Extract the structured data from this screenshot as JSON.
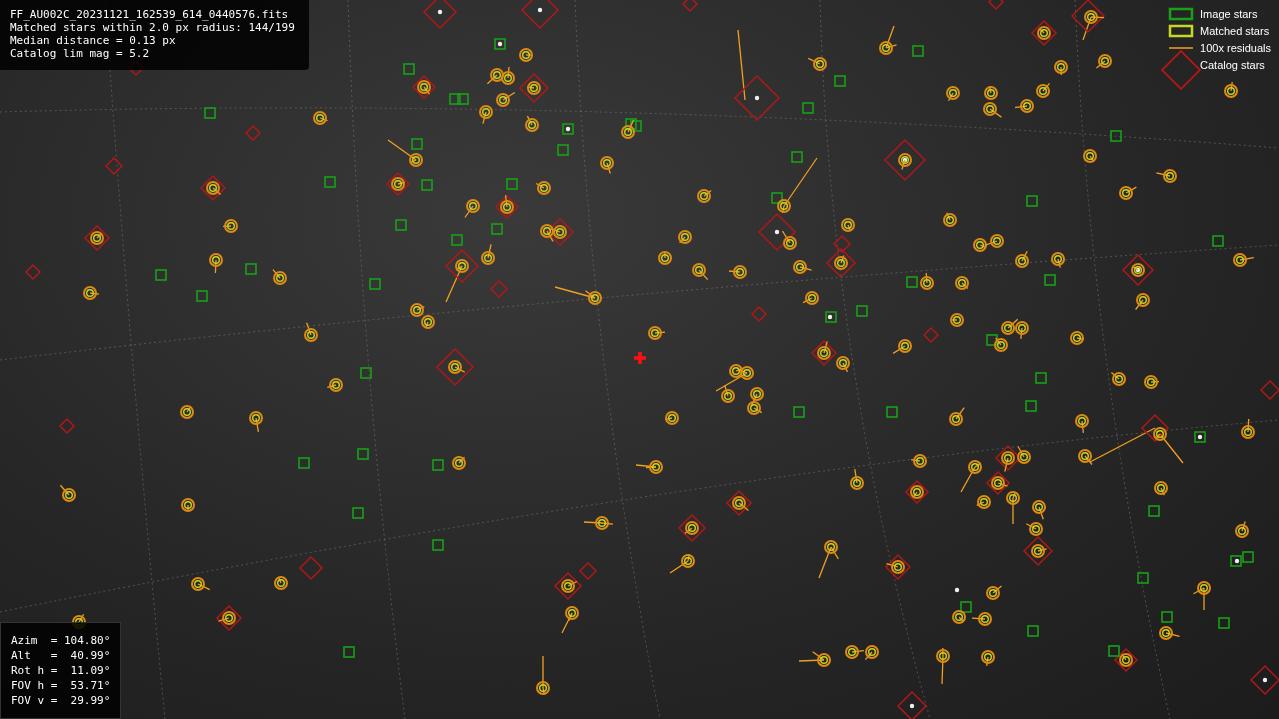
{
  "info_box": {
    "lines": [
      "FF_AU002C_20231121_162539_614_0440576.fits",
      "Matched stars within 2.0 px radius: 144/199",
      "Median distance = 0.13 px",
      "Catalog lim mag = 5.2"
    ]
  },
  "legend": [
    {
      "kind": "image",
      "label": "Image stars"
    },
    {
      "kind": "matched",
      "label": "Matched stars"
    },
    {
      "kind": "residual",
      "label": "100x residuals"
    },
    {
      "kind": "catalog",
      "label": "Catalog stars"
    }
  ],
  "pointing_box": {
    "lines": [
      "Azim  = 104.80°",
      "Alt   =  40.99°",
      "Rot h =  11.09°",
      "FOV h =  53.71°",
      "FOV v =  29.99°"
    ]
  }
}
